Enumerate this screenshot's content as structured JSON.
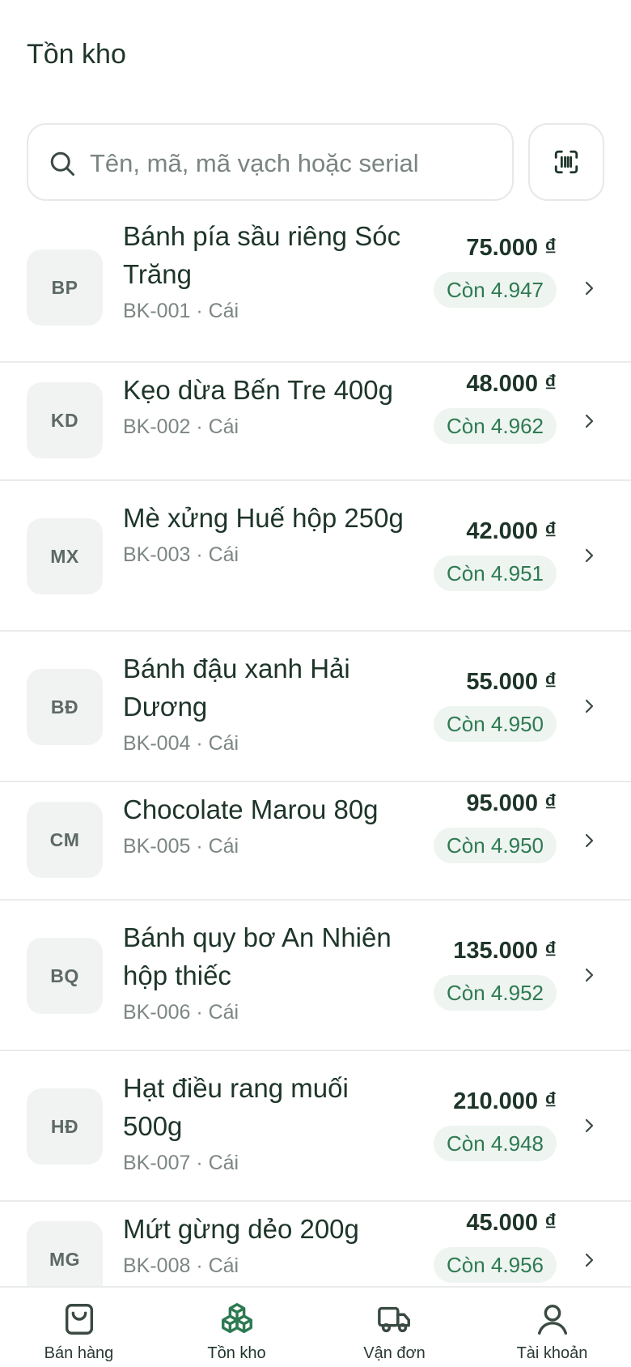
{
  "header": {
    "title": "Tồn kho"
  },
  "search": {
    "placeholder": "Tên, mã, mã vạch hoặc serial"
  },
  "products": [
    {
      "initials": "BP",
      "name": "Bánh pía sầu riêng Sóc Trăng",
      "meta": "BK-001 · Cái",
      "price": "75.000 ₫",
      "stock": "Còn 4.947"
    },
    {
      "initials": "KD",
      "name": "Kẹo dừa Bến Tre 400g",
      "meta": "BK-002 · Cái",
      "price": "48.000 ₫",
      "stock": "Còn 4.962"
    },
    {
      "initials": "MX",
      "name": "Mè xửng Huế hộp 250g",
      "meta": "BK-003 · Cái",
      "price": "42.000 ₫",
      "stock": "Còn 4.951"
    },
    {
      "initials": "BĐ",
      "name": "Bánh đậu xanh Hải Dương",
      "meta": "BK-004 · Cái",
      "price": "55.000 ₫",
      "stock": "Còn 4.950"
    },
    {
      "initials": "CM",
      "name": "Chocolate Marou 80g",
      "meta": "BK-005 · Cái",
      "price": "95.000 ₫",
      "stock": "Còn 4.950"
    },
    {
      "initials": "BQ",
      "name": "Bánh quy bơ An Nhiên hộp thiếc",
      "meta": "BK-006 · Cái",
      "price": "135.000 ₫",
      "stock": "Còn 4.952"
    },
    {
      "initials": "HĐ",
      "name": "Hạt điều rang muối 500g",
      "meta": "BK-007 · Cái",
      "price": "210.000 ₫",
      "stock": "Còn 4.948"
    },
    {
      "initials": "MG",
      "name": "Mứt gừng dẻo 200g",
      "meta": "BK-008 · Cái",
      "price": "45.000 ₫",
      "stock": "Còn 4.956"
    }
  ],
  "tabbar": {
    "tabs": [
      {
        "label": "Bán hàng",
        "icon": "shopping-bag-icon"
      },
      {
        "label": "Tồn kho",
        "icon": "boxes-icon",
        "active": true
      },
      {
        "label": "Vận đơn",
        "icon": "truck-icon"
      },
      {
        "label": "Tài khoản",
        "icon": "user-icon"
      }
    ]
  },
  "colors": {
    "accent": "#2e7a52",
    "stock_bg": "#eef4f0",
    "text": "#1e3529"
  }
}
